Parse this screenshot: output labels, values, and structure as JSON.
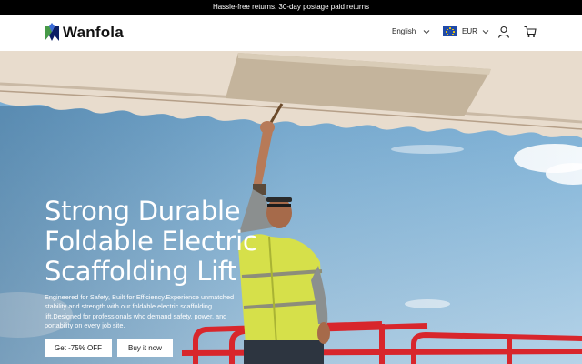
{
  "announcement": "Hassle-free returns. 30-day postage paid returns",
  "header": {
    "brand": "Wanfola",
    "language": "English",
    "currency": "EUR",
    "icons": [
      "chevron-down-icon",
      "eu-flag-icon",
      "user-icon",
      "cart-icon"
    ]
  },
  "hero": {
    "title": "Strong Durable Foldable Electric Scaffolding Lift",
    "description": "Engineered for Safety, Built for Efficiency.Experience unmatched stability and strength with our foldable electric scaffolding lift.Designed for professionals who demand safety, power, and portability on every job site.",
    "primary_button": "Get -75% OFF",
    "secondary_button": "Buy it now"
  },
  "colors": {
    "announcement_bg": "#000000",
    "sky": "#8fbcdc",
    "vest": "#d6e04a",
    "railing": "#d8262c"
  }
}
